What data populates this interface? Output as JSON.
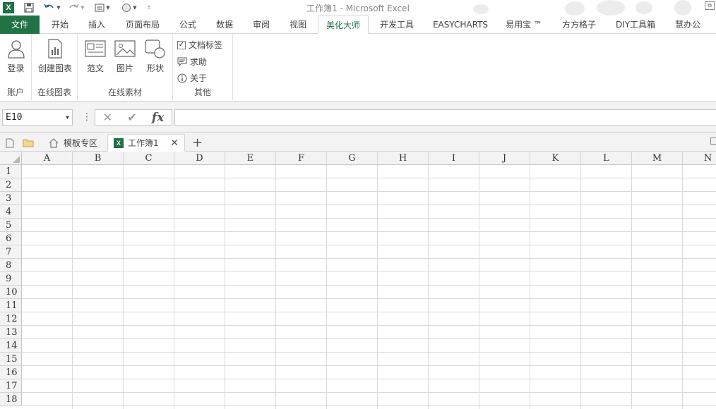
{
  "app": {
    "title": "工作簿1 - Microsoft Excel"
  },
  "tabs": [
    {
      "label": "文件",
      "kind": "file"
    },
    {
      "label": "开始"
    },
    {
      "label": "插入"
    },
    {
      "label": "页面布局"
    },
    {
      "label": "公式"
    },
    {
      "label": "数据"
    },
    {
      "label": "审阅"
    },
    {
      "label": "视图"
    },
    {
      "label": "美化大师",
      "active": true
    },
    {
      "label": "开发工具"
    },
    {
      "label": "EASYCHARTS"
    },
    {
      "label": "易用宝 ™"
    },
    {
      "label": "方方格子"
    },
    {
      "label": "DIY工具箱"
    },
    {
      "label": "慧办公"
    }
  ],
  "ribbon": {
    "account": {
      "login": "登录",
      "group": "账户"
    },
    "online_chart": {
      "create": "创建图表",
      "group": "在线图表"
    },
    "online_material": {
      "template": "范文",
      "picture": "图片",
      "shape": "形状",
      "group": "在线素材"
    },
    "other": {
      "doc_tabs": "文档标签",
      "help": "求助",
      "about": "关于",
      "group": "其他",
      "doc_tabs_checked": true
    }
  },
  "formula_bar": {
    "name_box": "E10",
    "cancel": "✕",
    "enter": "✔",
    "fx": "fx",
    "value": ""
  },
  "doc_tabs": {
    "template_zone": "模板专区",
    "workbook": "工作簿1",
    "add": "+"
  },
  "sheet": {
    "columns": [
      "A",
      "B",
      "C",
      "D",
      "E",
      "F",
      "G",
      "H",
      "I",
      "J",
      "K",
      "L",
      "M",
      "N"
    ],
    "rows": [
      "1",
      "2",
      "3",
      "4",
      "5",
      "6",
      "7",
      "8",
      "9",
      "10",
      "11",
      "12",
      "13",
      "14",
      "15",
      "16",
      "17",
      "18"
    ]
  },
  "colors": {
    "file_tab": "#217346",
    "active_tab_text": "#217346"
  }
}
